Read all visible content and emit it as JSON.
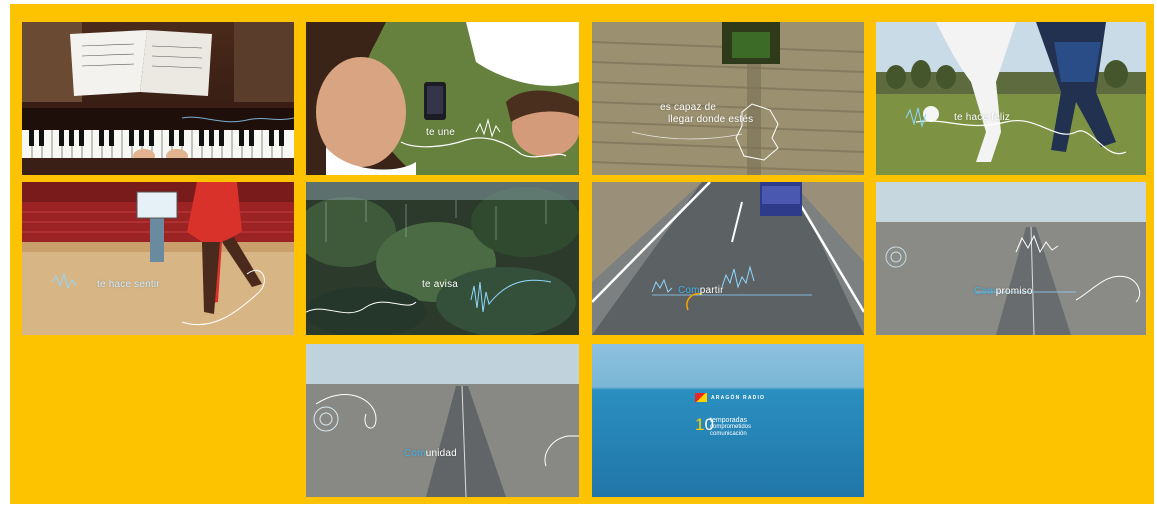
{
  "colors": {
    "frame": "#fdc300",
    "accent": "#3fb4ea",
    "line": "#ffffff"
  },
  "tiles": {
    "piano": {
      "icon": "piano-scene"
    },
    "couple": {
      "caption": "te une"
    },
    "tractor": {
      "caption_line1": "es capaz de",
      "caption_line2": "llegar donde estés"
    },
    "football": {
      "caption": "te hace feliz"
    },
    "basketball": {
      "caption": "te hace sentir"
    },
    "rain": {
      "caption": "te avisa"
    },
    "road_truck": {
      "caption_accent": "Com",
      "caption_rest": "partir"
    },
    "road_flat": {
      "caption_accent": "Com",
      "caption_rest": "promiso"
    },
    "road_community": {
      "caption_accent": "Com",
      "caption_rest": "unidad"
    },
    "sea": {
      "brand": "ARAGÓN RADIO",
      "number_accent": "1",
      "number_rest": "0",
      "line1": "temporadas",
      "line2": "comprometidos",
      "line3": "comunicación"
    }
  }
}
